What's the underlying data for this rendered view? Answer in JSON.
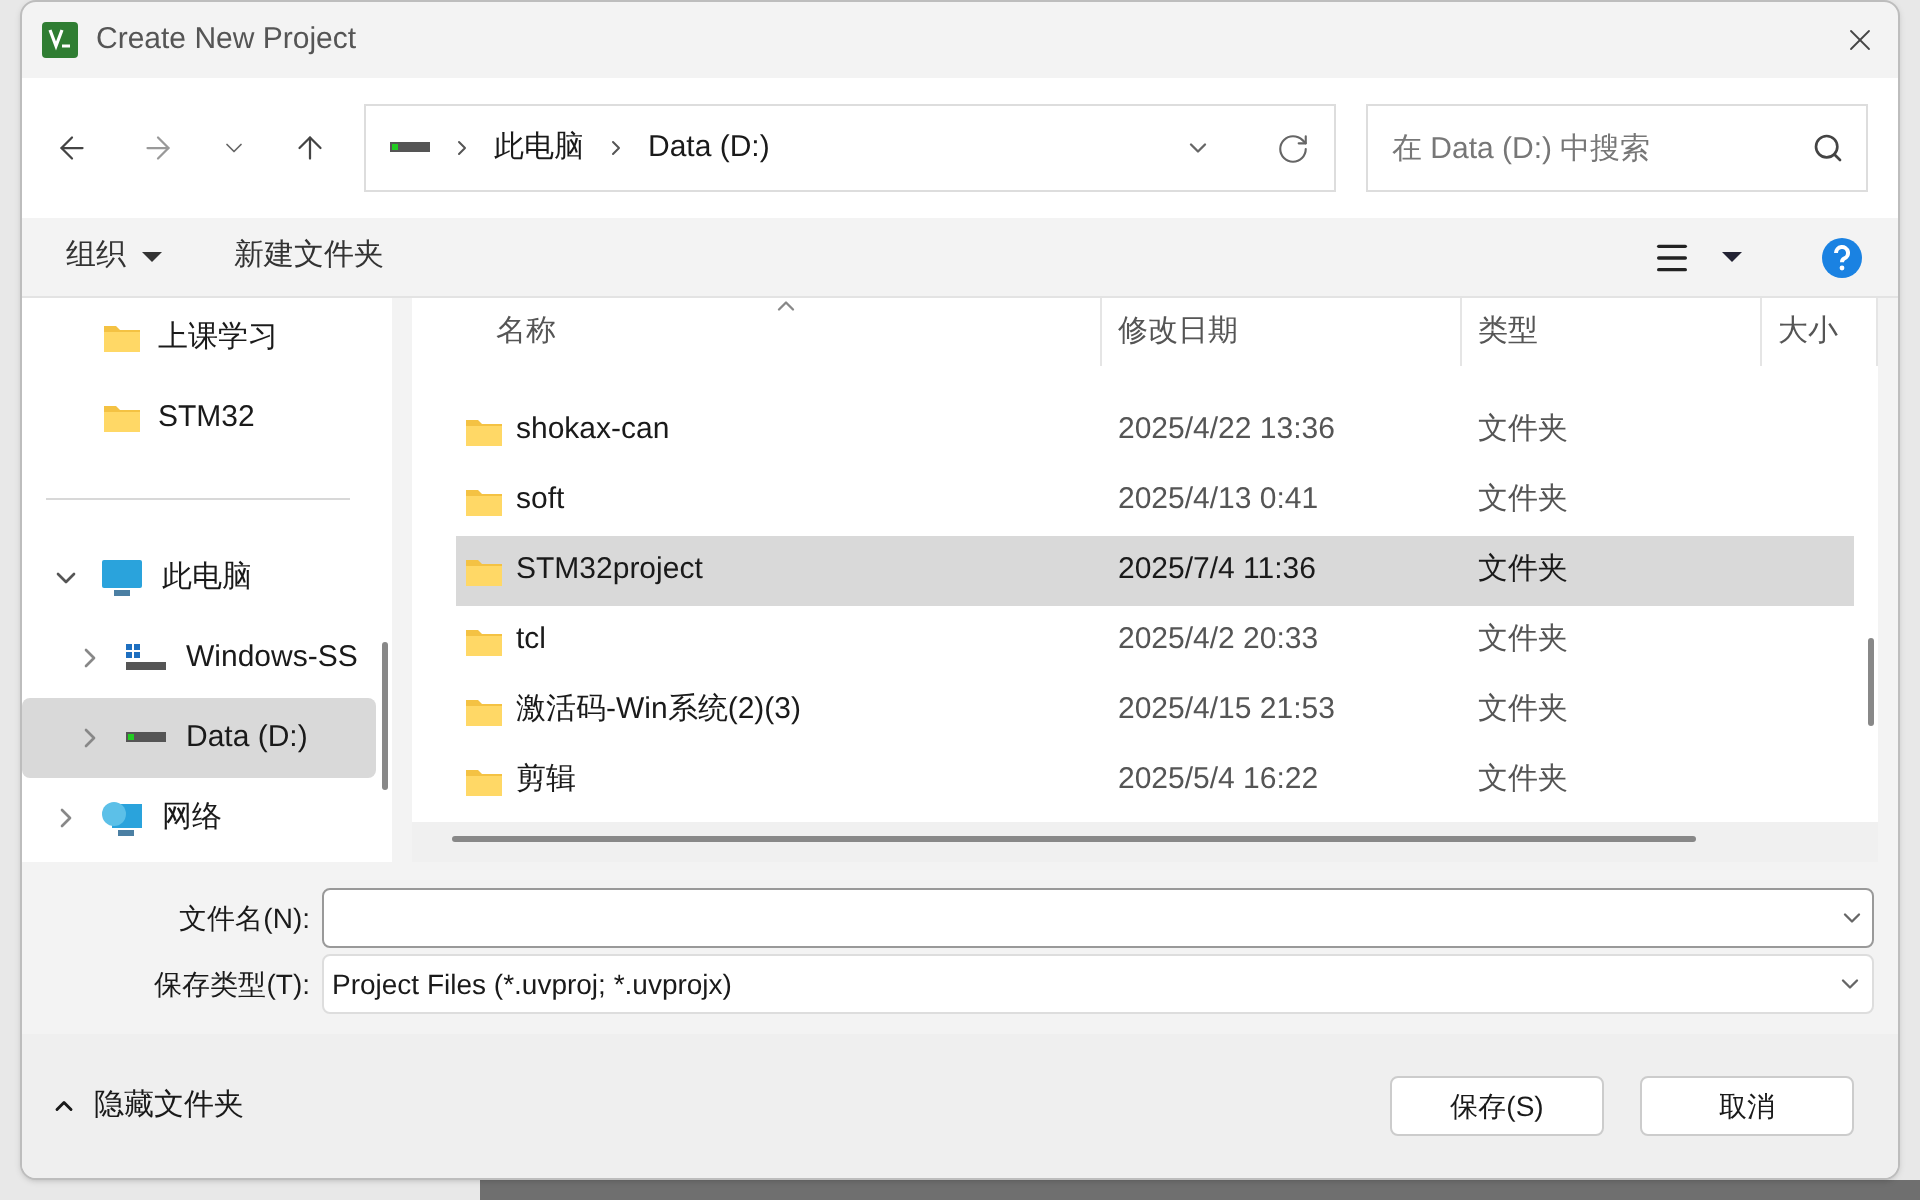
{
  "window": {
    "title": "Create New Project"
  },
  "address": {
    "crumbs": [
      "此电脑",
      "Data (D:)"
    ]
  },
  "search": {
    "placeholder": "在 Data (D:) 中搜索"
  },
  "toolbar": {
    "organize": "组织",
    "new_folder": "新建文件夹"
  },
  "sidebar": {
    "quick": [
      {
        "kind": "folder",
        "label": "上课学习",
        "selected": false
      },
      {
        "kind": "folder",
        "label": "STM32",
        "selected": false
      }
    ],
    "tree": [
      {
        "kind": "pc",
        "label": "此电脑",
        "expanded": true,
        "selected": false,
        "children": [
          {
            "kind": "system-drive",
            "label": "Windows-SS",
            "expanded": false,
            "selected": false
          },
          {
            "kind": "drive",
            "label": "Data (D:)",
            "expanded": false,
            "selected": true
          }
        ]
      },
      {
        "kind": "network",
        "label": "网络",
        "expanded": false,
        "selected": false
      }
    ]
  },
  "table": {
    "columns": [
      "名称",
      "修改日期",
      "类型",
      "大小"
    ],
    "rows": [
      {
        "name": "shokax-can",
        "date": "2025/4/22 13:36",
        "type": "文件夹",
        "selected": false
      },
      {
        "name": "soft",
        "date": "2025/4/13 0:41",
        "type": "文件夹",
        "selected": false
      },
      {
        "name": "STM32project",
        "date": "2025/7/4 11:36",
        "type": "文件夹",
        "selected": true
      },
      {
        "name": "tcl",
        "date": "2025/4/2 20:33",
        "type": "文件夹",
        "selected": false
      },
      {
        "name": "激活码-Win系统(2)(3)",
        "date": "2025/4/15 21:53",
        "type": "文件夹",
        "selected": false
      },
      {
        "name": "剪辑",
        "date": "2025/5/4 16:22",
        "type": "文件夹",
        "selected": false
      }
    ]
  },
  "form": {
    "filename_label": "文件名(N):",
    "type_label": "保存类型(T):",
    "type_value": "Project Files (*.uvproj; *.uvprojx)"
  },
  "footer": {
    "hide_folders": "隐藏文件夹",
    "save": "保存(S)",
    "cancel": "取消"
  }
}
